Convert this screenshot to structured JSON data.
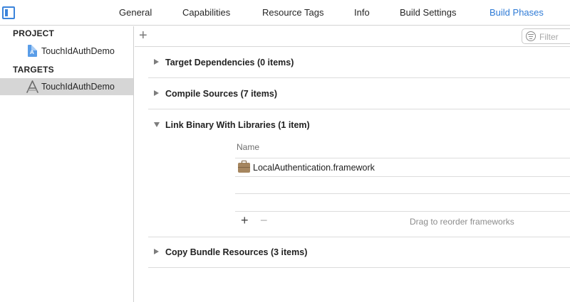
{
  "tabs": [
    {
      "label": "General",
      "active": false
    },
    {
      "label": "Capabilities",
      "active": false
    },
    {
      "label": "Resource Tags",
      "active": false
    },
    {
      "label": "Info",
      "active": false
    },
    {
      "label": "Build Settings",
      "active": false
    },
    {
      "label": "Build Phases",
      "active": true
    }
  ],
  "navigator": {
    "project_header": "PROJECT",
    "project_item": "TouchIdAuthDemo",
    "targets_header": "TARGETS",
    "target_item": "TouchIdAuthDemo"
  },
  "toolbar": {
    "add_symbol": "+",
    "filter_placeholder": "Filter"
  },
  "phases": [
    {
      "title": "Target Dependencies (0 items)",
      "expanded": false
    },
    {
      "title": "Compile Sources (7 items)",
      "expanded": false
    },
    {
      "title": "Link Binary With Libraries (1 item)",
      "expanded": true
    },
    {
      "title": "Copy Bundle Resources (3 items)",
      "expanded": false
    }
  ],
  "libraries": {
    "column_header": "Name",
    "items": [
      {
        "name": "LocalAuthentication.framework",
        "icon": "briefcase-icon"
      }
    ],
    "add_symbol": "+",
    "remove_symbol": "−",
    "drag_hint": "Drag to reorder frameworks"
  },
  "colors": {
    "accent": "#2f7bd6",
    "selection": "#d6d6d6",
    "framework_icon": "#a6865f"
  }
}
